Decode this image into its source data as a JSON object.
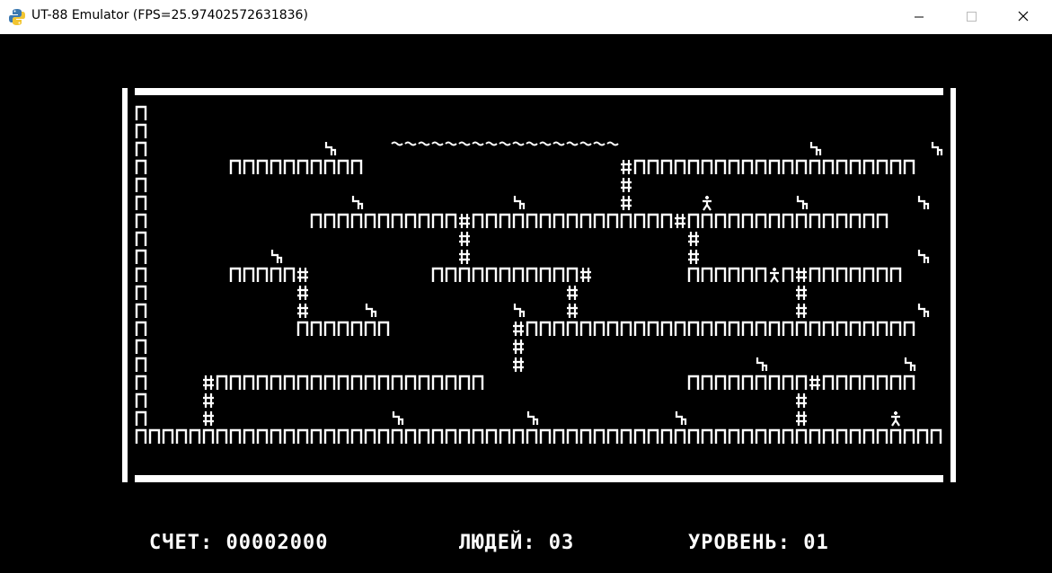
{
  "window": {
    "title": "UT-88 Emulator (FPS=25.97402572631836)",
    "app_icon": "python-icon",
    "minimize_icon": "minimize-icon",
    "maximize_icon": "maximize-icon",
    "close_icon": "close-icon"
  },
  "colors": {
    "background": "#000000",
    "foreground": "#ffffff",
    "titlebar": "#ffffff"
  },
  "game": {
    "map": [
      "П                                                            П",
      "П                                                            П",
      "П             Ч    ~~~~~~~~~~~~~~~~~              Ч        Ч    П",
      "П      ПППППППППП                   #ППППППППППППППППППППП     П",
      "П                                   #                          П",
      "П               Ч           Ч       #     Р      Ч        Ч     П",
      "П            ППППППППППП#ППППППППППППППП#ППППППППППППППП       П",
      "П                       #                #                     П",
      "П         Ч             #                #                Ч     П",
      "П      ППППП#         ППППППППППП#       ППППППРП#ППППППП      П",
      "П           #                   #                #             П",
      "П           #    Ч          Ч   #                #        Ч     П",
      "П           ППППППП         #ППППППППППППППППППППППППППППП      П",
      "П                           #                                  П",
      "П                           #                 Ч          Ч     П",
      "П    #ПППППППППППППППППППП               ППППППППП#ППППППП     П",
      "П    #                                           #             П",
      "П    #             Ч         Ч          Ч        #      Р      П",
      "ПППППППППППППППППППППППППППППППППППППППППППППППППППППППППППППП"
    ],
    "glyph_names": {
      "П": "brick",
      "#": "ladder",
      "~": "rope",
      "Ч": "gold",
      "Р": "enemy"
    }
  },
  "status": {
    "score_label": "СЧЕТ:",
    "score_value": "00002000",
    "lives_label": "ЛЮДЕЙ:",
    "lives_value": "03",
    "level_label": "УРОВЕНЬ:",
    "level_value": "01"
  }
}
